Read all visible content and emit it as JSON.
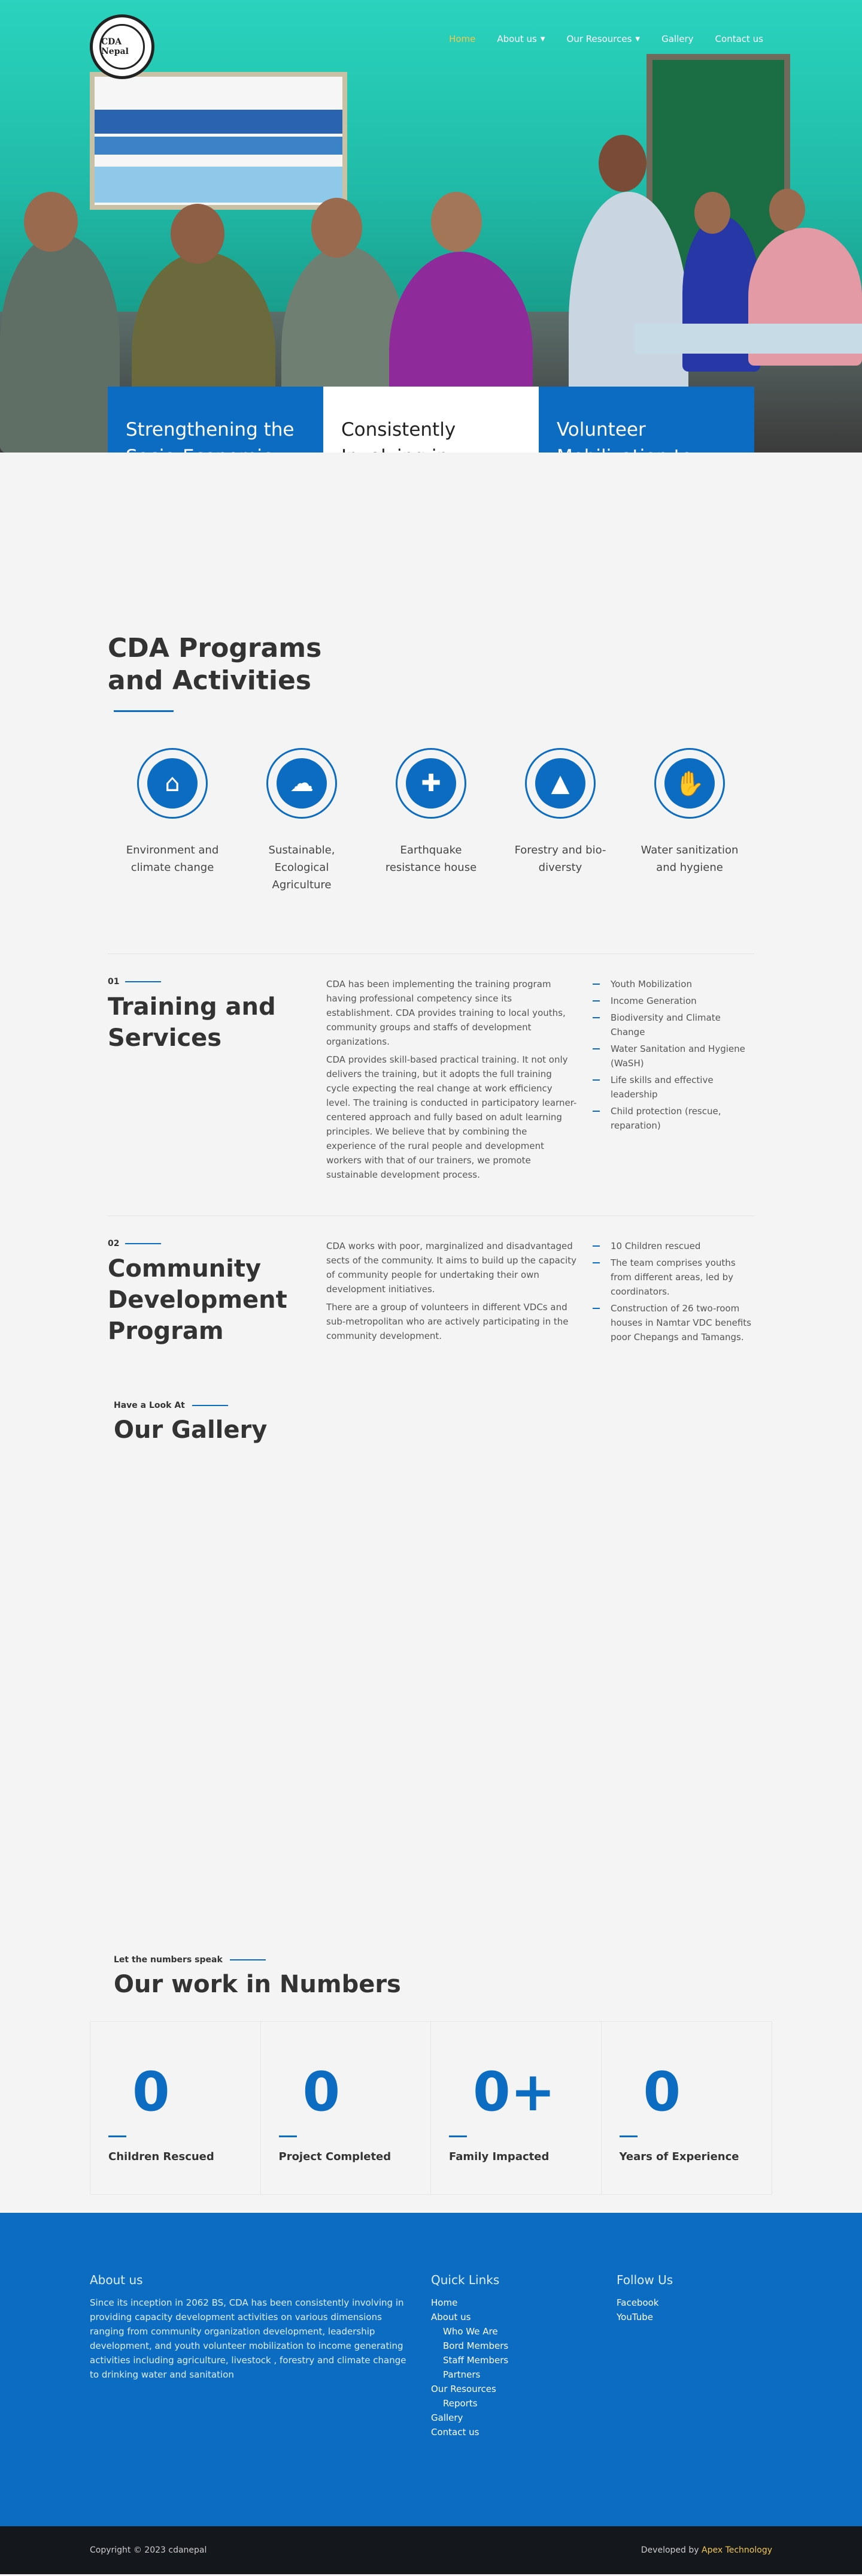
{
  "nav": {
    "logo_text": "CDA Nepal",
    "items": [
      {
        "label": "Home",
        "active": true,
        "dropdown": false
      },
      {
        "label": "About us",
        "active": false,
        "dropdown": true
      },
      {
        "label": "Our Resources",
        "active": false,
        "dropdown": true
      },
      {
        "label": "Gallery",
        "active": false,
        "dropdown": false
      },
      {
        "label": "Contact us",
        "active": false,
        "dropdown": false
      }
    ]
  },
  "features": [
    "Strengthening the Socio-Economic Empowerment of the Vulnerable Community",
    "Consistently Involving in Providing Capacity Development Activities",
    "Volunteer Mobilization to Income Generating Activities"
  ],
  "programs": {
    "title": "CDA Programs and Activities",
    "items": [
      {
        "icon": "home-icon",
        "label": "Environment and climate change"
      },
      {
        "icon": "cloud-moon-icon",
        "label": "Sustainable, Ecological Agriculture"
      },
      {
        "icon": "house-plus-icon",
        "label": "Earthquake resistance house"
      },
      {
        "icon": "tree-icon",
        "label": "Forestry and bio-diversty"
      },
      {
        "icon": "hand-wash-icon",
        "label": "Water sanitization and hygiene"
      }
    ]
  },
  "training": {
    "num": "01",
    "title": "Training and Services",
    "p1": "CDA has been implementing the training program having professional competency since its establishment. CDA provides training to local youths, community groups and staffs of development organizations.",
    "p2": "CDA provides skill-based practical training. It not only delivers the training, but it adopts the full training cycle expecting the real change at work efficiency level. The training is conducted in participatory learner-centered approach and fully based on adult learning principles. We believe that by combining the experience of the rural people and development workers with that of our trainers, we promote sustainable development process.",
    "list": [
      "Youth Mobilization",
      "Income Generation",
      "Biodiversity and Climate Change",
      "Water Sanitation and Hygiene (WaSH)",
      "Life skills and effective leadership",
      "Child protection (rescue, reparation)"
    ]
  },
  "community": {
    "num": "02",
    "title": "Community Development Program",
    "p1": "CDA works with poor, marginalized and disadvantaged sects of the community. It aims to build up the capacity of community people for undertaking their own development initiatives.",
    "p2": "There are a group of volunteers in different VDCs and sub-metropolitan who are actively participating in the community development.",
    "list": [
      "10 Children rescued",
      "The team comprises youths from different areas, led by coordinators.",
      "Construction of 26 two-room houses in Namtar VDC benefits poor Chepangs and Tamangs."
    ]
  },
  "gallery": {
    "eyebrow": "Have a Look At",
    "title": "Our Gallery"
  },
  "numbers": {
    "eyebrow": "Let the numbers speak",
    "title": "Our work in Numbers",
    "counters": [
      {
        "value": "0",
        "label": "Children Rescued"
      },
      {
        "value": "0",
        "label": "Project Completed"
      },
      {
        "value": "0+",
        "label": "Family Impacted"
      },
      {
        "value": "0",
        "label": "Years of Experience"
      }
    ]
  },
  "footer": {
    "about_title": "About us",
    "about_text": "Since its inception in 2062 BS, CDA has been consistently involving in providing capacity development activities on various dimensions ranging from community organization development, leadership development, and youth volunteer mobilization to income generating activities including agriculture, livestock , forestry and climate change to drinking water and sanitation",
    "links_title": "Quick Links",
    "links": [
      {
        "label": "Home",
        "sub": false
      },
      {
        "label": "About us",
        "sub": false
      },
      {
        "label": "Who We Are",
        "sub": true
      },
      {
        "label": "Bord Members",
        "sub": true
      },
      {
        "label": "Staff Members",
        "sub": true
      },
      {
        "label": "Partners",
        "sub": true
      },
      {
        "label": "Our Resources",
        "sub": false
      },
      {
        "label": "Reports",
        "sub": true
      },
      {
        "label": "Gallery",
        "sub": false
      },
      {
        "label": "Contact us",
        "sub": false
      }
    ],
    "follow_title": "Follow Us",
    "social": [
      "Facebook",
      "YouTube"
    ]
  },
  "bottom": {
    "copyright": "Copyright © 2023 cdanepal",
    "dev_prefix": "Developed by",
    "dev_name": "Apex Technology"
  },
  "colors": {
    "primary": "#0b6cc1",
    "accent": "#f2c94c",
    "dark": "#14171c"
  }
}
